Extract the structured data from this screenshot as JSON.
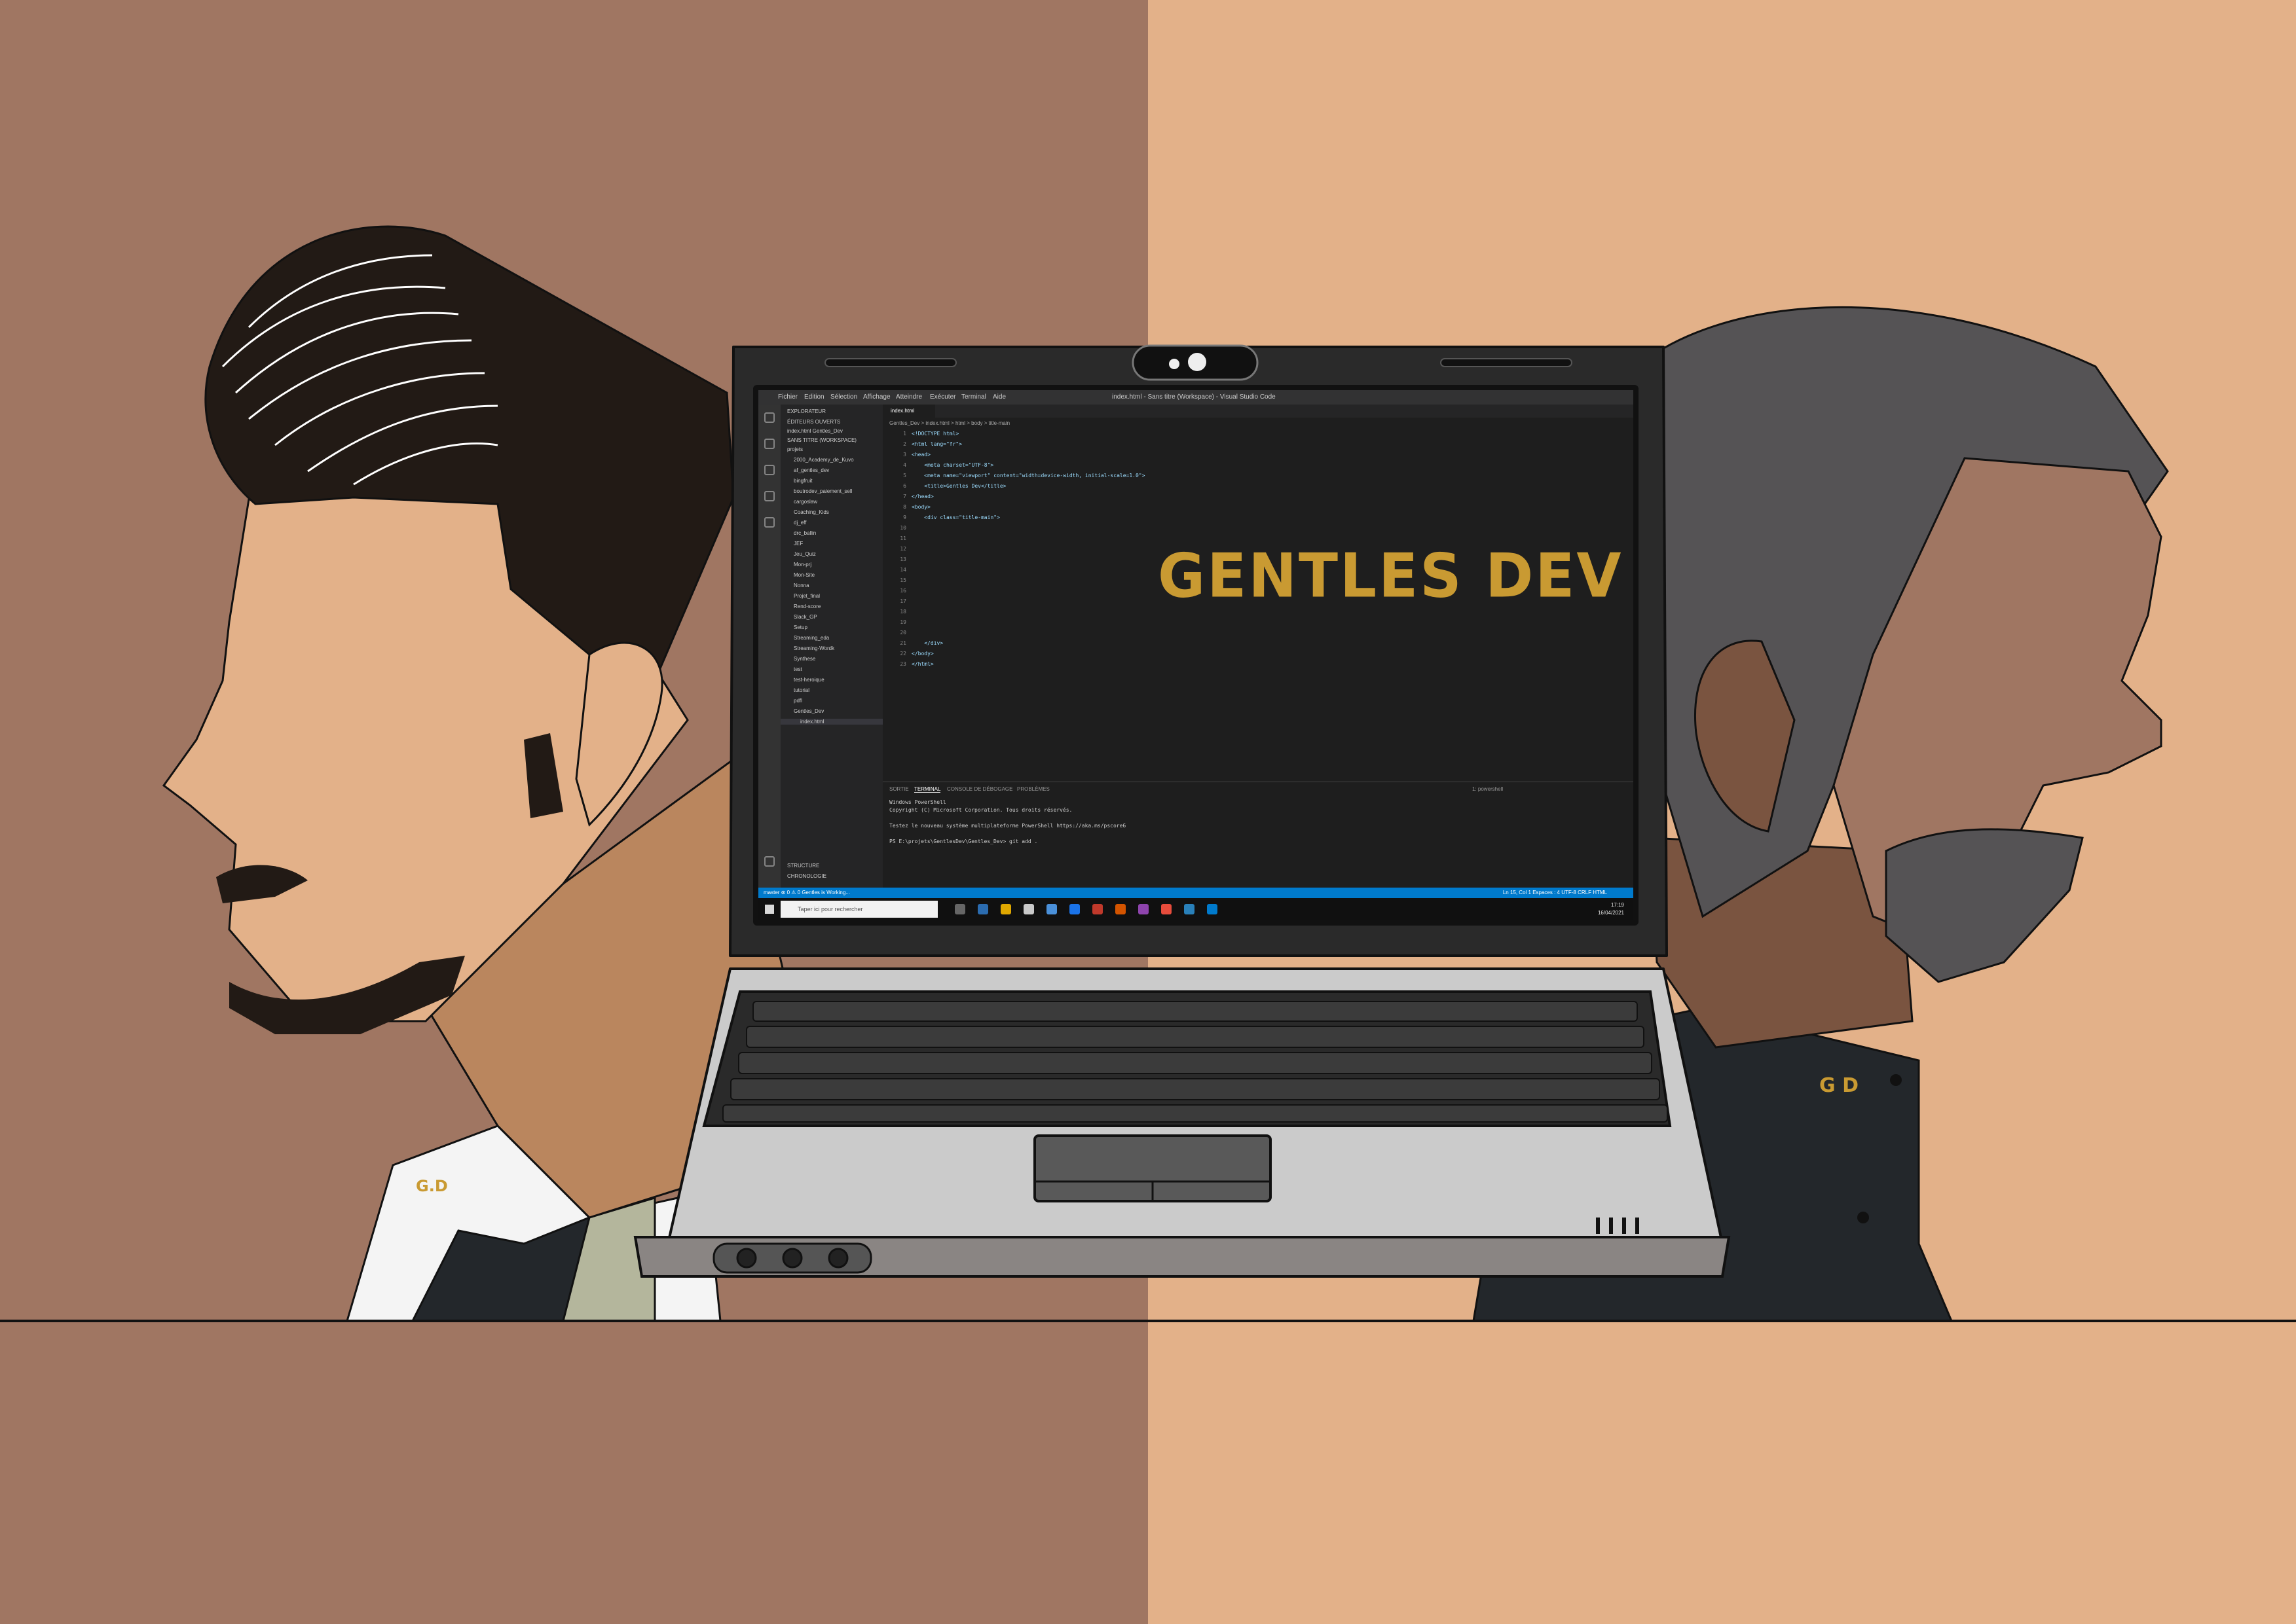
{
  "background": {
    "left_color": "#a07662",
    "right_color": "#e3b189",
    "table_line_color": "#111111"
  },
  "illustration": {
    "logo_text": "GENTLES DEV",
    "logo_color": "#c99a32",
    "shirt_monogram_left": "G.D",
    "shirt_monogram_right": "G D"
  },
  "vscode": {
    "menu": [
      "Fichier",
      "Edition",
      "Sélection",
      "Affichage",
      "Atteindre",
      "Exécuter",
      "Terminal",
      "Aide"
    ],
    "window_title": "index.html - Sans titre (Workspace) - Visual Studio Code",
    "sidebar": {
      "header": "EXPLORATEUR",
      "open_editors": "ÉDITEURS OUVERTS",
      "open_file": "index.html  Gentles_Dev",
      "workspace": "SANS TITRE (WORKSPACE)",
      "root": "projets",
      "items": [
        "2000_Academy_de_Kuvo",
        "af_gentles_dev",
        "bingfruit",
        "boutrodev_paiement_sell",
        "cargoslaw",
        "Coaching_Kids",
        "dj_eff",
        "drc_ballin",
        "JEF",
        "Jeu_Quiz",
        "Mon-prj",
        "Mon-Site",
        "Nonna",
        "Projet_final",
        "Rend-score",
        "Slack_GP",
        "Setup",
        "Streaming_eda",
        "Streaming-Wordk",
        "Synthese",
        "test",
        "test-heroique",
        "tutorial",
        "pdfl",
        "Gentles_Dev",
        "index.html"
      ],
      "outline": "STRUCTURE",
      "timeline": "CHRONOLOGIE"
    },
    "editor": {
      "tab": "index.html",
      "breadcrumb": "Gentles_Dev > index.html > html > body > title-main",
      "lines": [
        "<!DOCTYPE html>",
        "<html lang=\"fr\">",
        "<head>",
        "    <meta charset=\"UTF-8\">",
        "    <meta name=\"viewport\" content=\"width=device-width, initial-scale=1.0\">",
        "    <title>Gentles Dev</title>",
        "</head>",
        "<body>",
        "    <div class=\"title-main\">",
        "",
        "",
        "",
        "",
        "",
        "",
        "",
        "",
        "",
        "",
        "",
        "    </div>",
        "</body>",
        "</html>"
      ]
    },
    "panel": {
      "tabs": [
        "SORTIE",
        "TERMINAL",
        "CONSOLE DE DÉBOGAGE",
        "PROBLÈMES"
      ],
      "active_tab": "TERMINAL",
      "shell": "1: powershell",
      "terminal_lines": [
        "Windows PowerShell",
        "Copyright (C) Microsoft Corporation. Tous droits réservés.",
        "",
        "Testez le nouveau système multiplateforme PowerShell https://aka.ms/pscore6",
        "",
        "PS E:\\projets\\GentlesDev\\Gentles_Dev> git add ."
      ]
    },
    "statusbar": {
      "left": "master  ⊗ 0 ⚠ 0   Gentles is Working...",
      "right": "Ln 15, Col 1   Espaces : 4   UTF-8   CRLF   HTML"
    },
    "taskbar": {
      "search_placeholder": "Taper ici pour rechercher",
      "time": "17:19",
      "date": "16/04/2021"
    }
  }
}
